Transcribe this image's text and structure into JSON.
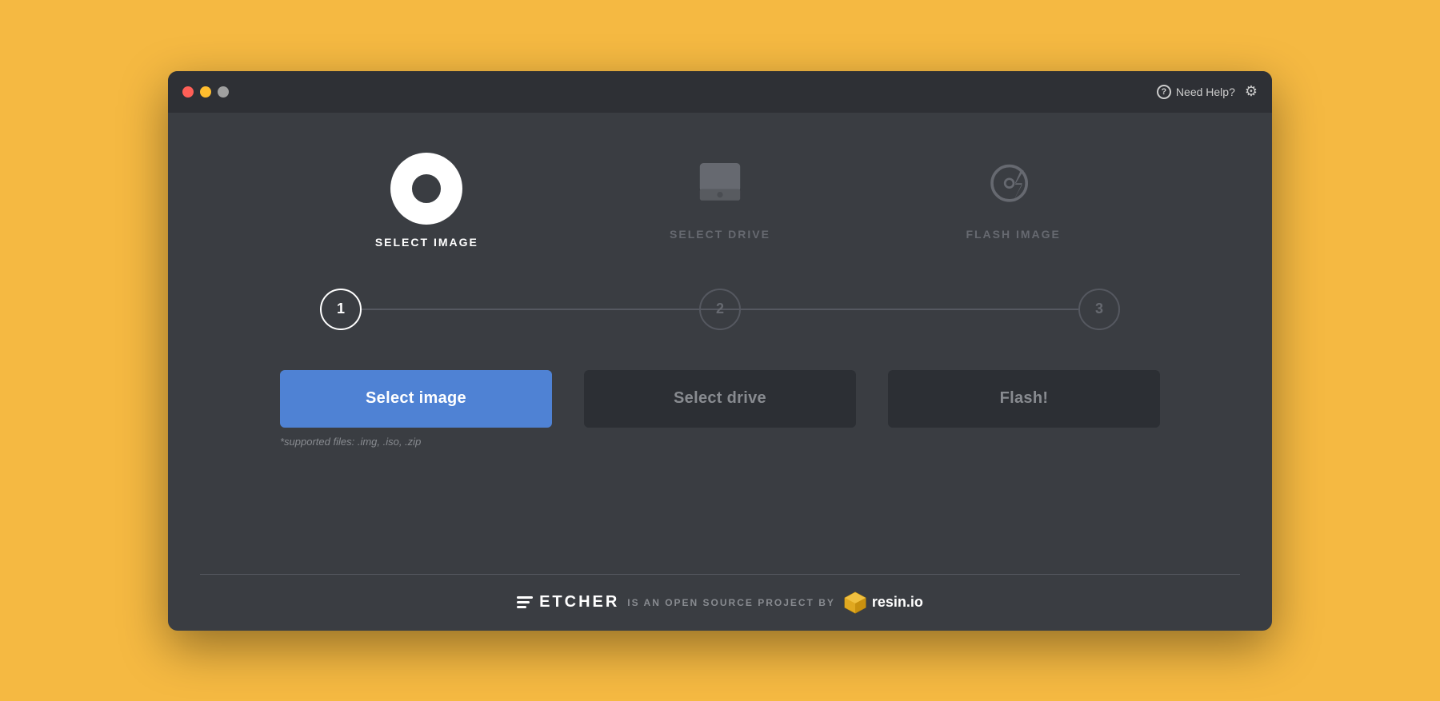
{
  "window": {
    "traffic_lights": [
      "close",
      "minimize",
      "maximize"
    ],
    "help_label": "Need Help?",
    "help_icon": "?",
    "settings_icon": "⚙"
  },
  "steps": [
    {
      "id": "select-image",
      "icon_type": "disc",
      "label": "SELECT IMAGE",
      "number": "1",
      "active": true
    },
    {
      "id": "select-drive",
      "icon_type": "drive",
      "label": "SELECT DRIVE",
      "number": "2",
      "active": false
    },
    {
      "id": "flash-image",
      "icon_type": "flash",
      "label": "FLASH IMAGE",
      "number": "3",
      "active": false
    }
  ],
  "buttons": [
    {
      "id": "select-image-btn",
      "label": "Select image",
      "type": "primary",
      "note": "*supported files: .img, .iso, .zip"
    },
    {
      "id": "select-drive-btn",
      "label": "Select drive",
      "type": "secondary",
      "note": ""
    },
    {
      "id": "flash-btn",
      "label": "Flash!",
      "type": "dark",
      "note": ""
    }
  ],
  "footer": {
    "etcher_label": "ETCHER",
    "tagline": "IS AN OPEN SOURCE PROJECT BY",
    "resin_label": "resin.io"
  }
}
